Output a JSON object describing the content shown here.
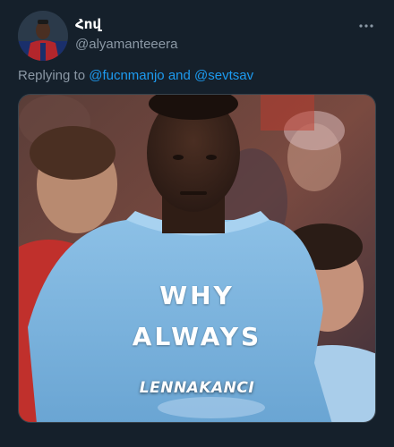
{
  "tweet": {
    "display_name": "Հով",
    "handle": "@alyamanteeera",
    "more_icon": "more-horizontal-icon",
    "reply": {
      "prefix": "Replying to ",
      "mention_1": "@fucnmanjo",
      "joiner": " and ",
      "mention_2": "@sevtsav"
    },
    "media": {
      "shirt_line_1": "WHY",
      "shirt_line_2": "ALWAYS",
      "caption": "LENNAKANCI"
    }
  },
  "colors": {
    "background": "#15202b",
    "link": "#1d9bf0",
    "secondary_text": "#8b98a5",
    "shirt": "#7fb4dd"
  }
}
